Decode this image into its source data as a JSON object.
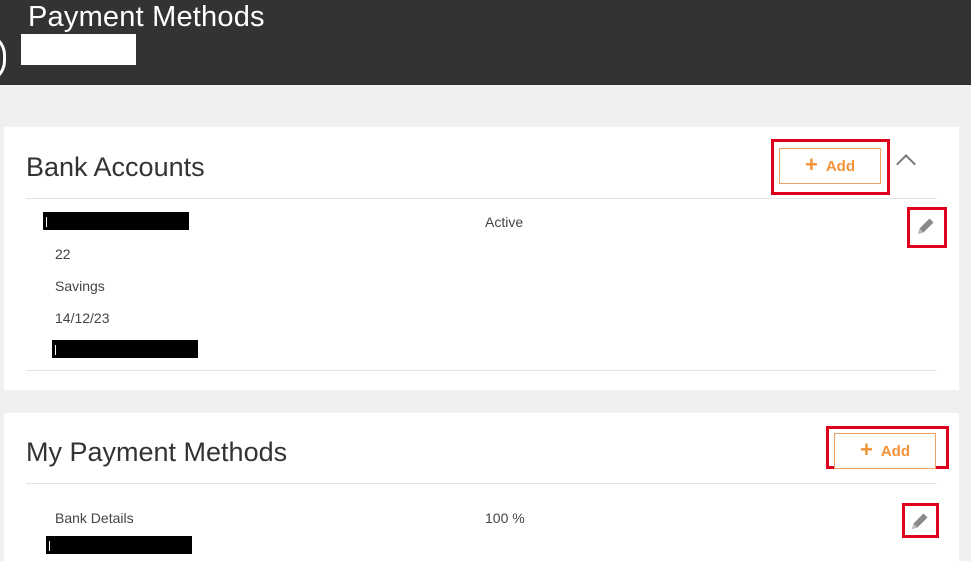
{
  "header": {
    "title": "Payment Methods"
  },
  "bank_accounts": {
    "title": "Bank Accounts",
    "add_label": "Add",
    "entry": {
      "status": "Active",
      "number": "22",
      "type": "Savings",
      "date": "14/12/23"
    }
  },
  "my_payment_methods": {
    "title": "My Payment Methods",
    "add_label": "Add",
    "entry": {
      "label": "Bank Details",
      "percent": "100 %"
    }
  },
  "icons": {
    "add": "plus-icon",
    "collapse": "chevron-up-icon",
    "edit": "pencil-icon"
  },
  "colors": {
    "header_bg": "#333333",
    "accent": "#f39237",
    "highlight": "#e0001b"
  }
}
